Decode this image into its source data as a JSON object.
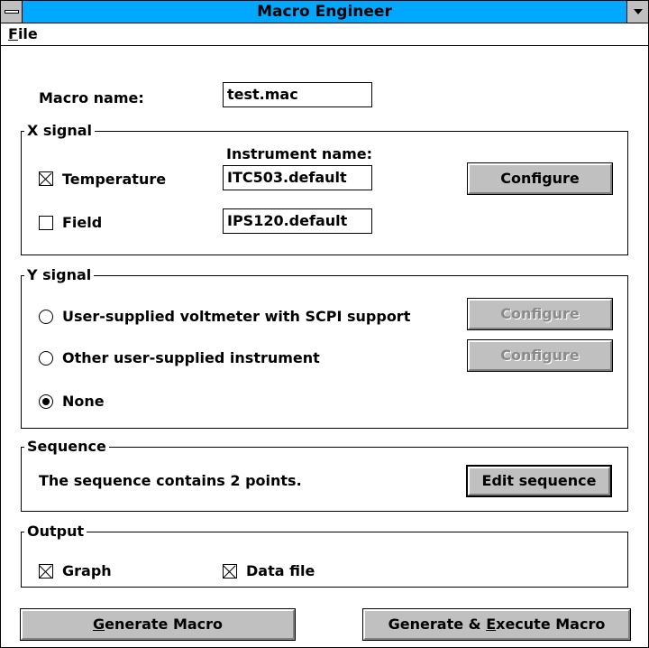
{
  "window": {
    "title": "Macro Engineer"
  },
  "menu": {
    "file_underlined": "F",
    "file_rest": "ile"
  },
  "macro": {
    "label": "Macro name:",
    "value": "test.mac"
  },
  "x_signal": {
    "legend": "X signal",
    "instrument_header": "Instrument name:",
    "temperature": {
      "label": "Temperature",
      "checked": true,
      "instrument": "ITC503.default"
    },
    "field": {
      "label": "Field",
      "checked": false,
      "instrument": "IPS120.default"
    },
    "configure_label": "Configure"
  },
  "y_signal": {
    "legend": "Y signal",
    "options": [
      {
        "label": "User-supplied voltmeter with SCPI support",
        "selected": false,
        "configure_label": "Configure"
      },
      {
        "label": "Other user-supplied instrument",
        "selected": false,
        "configure_label": "Configure"
      },
      {
        "label": "None",
        "selected": true
      }
    ]
  },
  "sequence": {
    "legend": "Sequence",
    "text": "The sequence contains 2 points.",
    "edit_label": "Edit sequence"
  },
  "output": {
    "legend": "Output",
    "graph": {
      "label": "Graph",
      "checked": true
    },
    "data_file": {
      "label": "Data file",
      "checked": true
    }
  },
  "buttons": {
    "generate_u": "G",
    "generate_rest": "enerate Macro",
    "generate_exec_pre": "Generate & ",
    "generate_exec_u": "E",
    "generate_exec_rest": "xecute Macro"
  },
  "colors": {
    "titlebar": "#00a8ff",
    "button_face": "#c0c0c0",
    "disabled_text": "#8a8a8a"
  }
}
